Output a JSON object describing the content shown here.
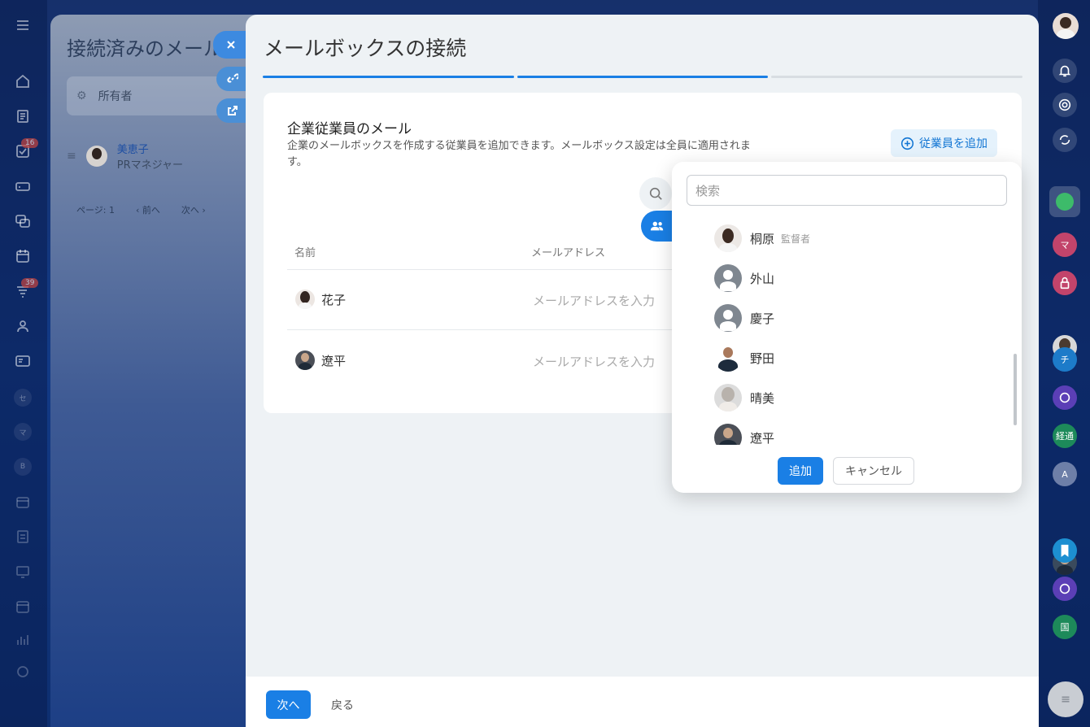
{
  "left_nav": {
    "badges": [
      "16",
      "39"
    ],
    "letters": [
      "セ",
      "マ",
      "B"
    ]
  },
  "right_nav": {
    "letters": [
      "マ",
      "チ",
      "経通",
      "A",
      "国"
    ]
  },
  "back_panel": {
    "title": "接続済みのメールボックス",
    "filter_label": "所有者",
    "row_name": "美恵子",
    "row_role": "PRマネジャー",
    "pager_page": "ページ: 1",
    "pager_prev": "前へ",
    "pager_next": "次へ"
  },
  "modal": {
    "title": "メールボックスの接続",
    "card_title": "企業従業員のメール",
    "card_desc": "企業のメールボックスを作成する従業員を追加できます。メールボックス設定は全員に適用されます。",
    "add_employee_label": "従業員を追加",
    "columns": {
      "name": "名前",
      "email": "メールアドレス"
    },
    "employees": [
      {
        "name": "花子",
        "email_placeholder": "メールアドレスを入力"
      },
      {
        "name": "遼平",
        "email_placeholder": "メールアドレスを入力"
      }
    ],
    "next_label": "次へ",
    "back_label": "戻る"
  },
  "popup": {
    "search_placeholder": "検索",
    "items": [
      {
        "name": "桐原",
        "sub": "監督者"
      },
      {
        "name": "外山",
        "sub": ""
      },
      {
        "name": "慶子",
        "sub": ""
      },
      {
        "name": "野田",
        "sub": ""
      },
      {
        "name": "晴美",
        "sub": ""
      },
      {
        "name": "遼平",
        "sub": ""
      }
    ],
    "add_label": "追加",
    "cancel_label": "キャンセル"
  },
  "colors": {
    "accent": "#1a7fe5",
    "progress_done": "#1a7fe5",
    "progress_todo": "#d8dde2"
  }
}
